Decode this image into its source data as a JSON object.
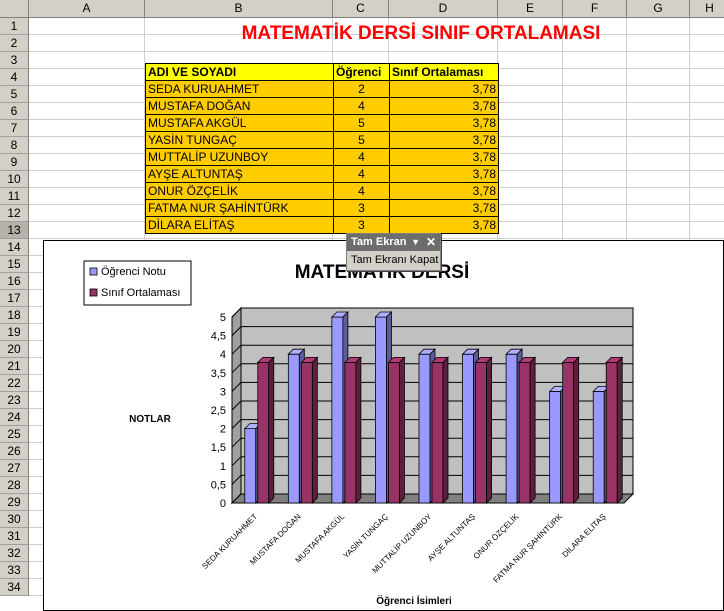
{
  "sheet": {
    "columns": [
      "A",
      "B",
      "C",
      "D",
      "E",
      "F",
      "G",
      "H"
    ],
    "rows": [
      "1",
      "2",
      "3",
      "4",
      "5",
      "6",
      "7",
      "8",
      "9",
      "10",
      "11",
      "12",
      "13",
      "14",
      "15",
      "16",
      "17",
      "18",
      "19",
      "20",
      "21",
      "22",
      "23",
      "24",
      "25",
      "26",
      "27",
      "28",
      "29",
      "30",
      "31",
      "32",
      "33",
      "34"
    ],
    "active_row": "13",
    "title": "MATEMATİK DERSİ SINIF ORTALAMASI",
    "table": {
      "headers": [
        "ADI VE SOYADI",
        "Öğrenci",
        "Sınıf Ortalaması"
      ],
      "rows": [
        [
          "SEDA KURUAHMET",
          "2",
          "3,78"
        ],
        [
          "MUSTAFA DOĞAN",
          "4",
          "3,78"
        ],
        [
          "MUSTAFA AKGÜL",
          "5",
          "3,78"
        ],
        [
          "YASİN TUNGAÇ",
          "5",
          "3,78"
        ],
        [
          "MUTTALİP UZUNBOY",
          "4",
          "3,78"
        ],
        [
          "AYŞE ALTUNTAŞ",
          "4",
          "3,78"
        ],
        [
          "ONUR ÖZÇELİK",
          "4",
          "3,78"
        ],
        [
          "FATMA NUR ŞAHİNTÜRK",
          "3",
          "3,78"
        ],
        [
          "DİLARA ELİTAŞ",
          "3",
          "3,78"
        ]
      ]
    }
  },
  "toolbar": {
    "title": "Tam Ekran",
    "dropdown_icon": "dropdown-arrow-icon",
    "close_icon": "close-icon",
    "button_label": "Tam Ekranı Kapat"
  },
  "chart_data": {
    "type": "bar",
    "title": "MATEMATİK DERSİ",
    "xlabel": "Öğrenci İsimleri",
    "ylabel": "NOTLAR",
    "ylim": [
      0,
      5
    ],
    "yticks": [
      "0",
      "0,5",
      "1",
      "1,5",
      "2",
      "2,5",
      "3",
      "3,5",
      "4",
      "4,5",
      "5"
    ],
    "grid": true,
    "legend_position": "top-left",
    "categories": [
      "SEDA KURUAHMET",
      "MUSTAFA DOĞAN",
      "MUSTAFA AKGÜL",
      "YASİN TUNGAÇ",
      "MUTTALİP UZUNBOY",
      "AYŞE ALTUNTAŞ",
      "ONUR ÖZÇELİK",
      "FATMA NUR ŞAHİNTÜRK",
      "DİLARA ELİTAŞ"
    ],
    "series": [
      {
        "name": "Öğrenci Notu",
        "values": [
          2,
          4,
          5,
          5,
          4,
          4,
          4,
          3,
          3
        ],
        "color": "#9999ff"
      },
      {
        "name": "Sınıf Ortalaması",
        "values": [
          3.78,
          3.78,
          3.78,
          3.78,
          3.78,
          3.78,
          3.78,
          3.78,
          3.78
        ],
        "color": "#993366"
      }
    ]
  }
}
